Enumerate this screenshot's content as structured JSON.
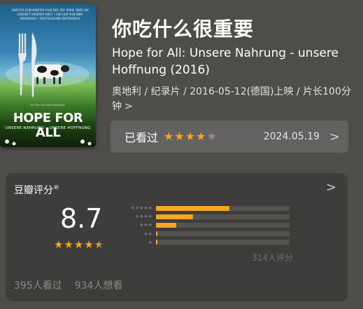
{
  "poster": {
    "top_text": "Zweiter Dokumentar Film der ZDF Reihe über die Zukunft unserer Welt • Ein Film von Nina Messinger • Deutschland Österreich",
    "credit": "Ein Film von Nina Messinger",
    "title": "HOPE FOR ALL",
    "subtitle": "UNSERE NAHRUNG – UNSERE HOFFNUNG"
  },
  "movie": {
    "title_cn": "你吃什么很重要",
    "title_original": "Hope for All: Unsere Nahrung - unsere Hoffnung (2016)",
    "meta": "奥地利 / 纪录片 / 2016-05-12(德国)上映 / 片长100分钟",
    "meta_chevron": ">"
  },
  "watched": {
    "label": "已看过",
    "rating": 4,
    "max_rating": 5,
    "date": "2024.05.19",
    "chevron": ">"
  },
  "rating": {
    "title": "豆瓣评分",
    "registered": "®",
    "chevron": ">",
    "score": "8.7",
    "stars": 4.5,
    "distribution": [
      {
        "stars": "★★★★★",
        "fraction": 0.55
      },
      {
        "stars": "★★★★",
        "fraction": 0.28
      },
      {
        "stars": "★★★",
        "fraction": 0.15
      },
      {
        "stars": "★★",
        "fraction": 0.01
      },
      {
        "stars": "★",
        "fraction": 0.005
      }
    ],
    "count": "314人评分",
    "watched_count": "395人看过",
    "want_count": "934人想看"
  },
  "colors": {
    "accent": "#f5a623",
    "background": "#4e4d4a",
    "card": "#3e3d3b"
  }
}
